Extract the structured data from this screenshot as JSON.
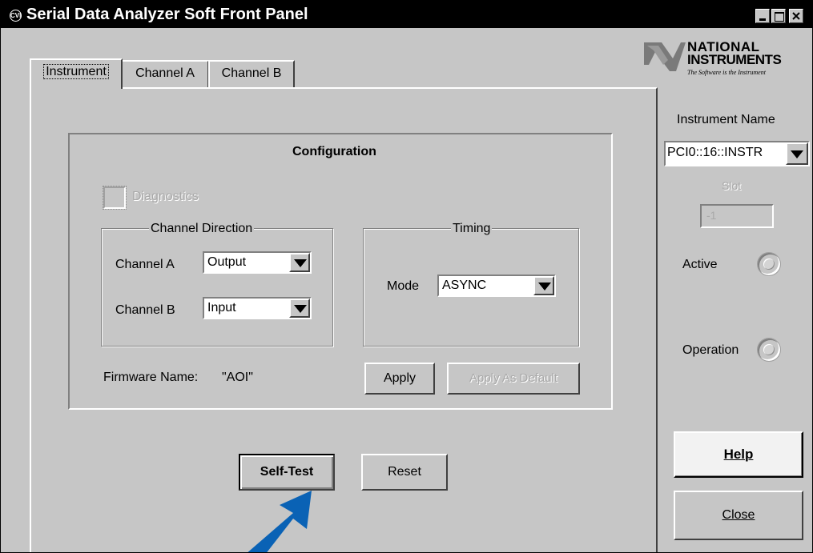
{
  "window": {
    "title": "Serial Data Analyzer Soft Front Panel",
    "app_icon": "CVI",
    "controls": [
      "minimize",
      "maximize",
      "close"
    ]
  },
  "tabs": [
    {
      "label": "Instrument",
      "active": true
    },
    {
      "label": "Channel A",
      "active": false
    },
    {
      "label": "Channel B",
      "active": false
    }
  ],
  "configuration": {
    "title": "Configuration",
    "diagnostics_label": "Diagnostics",
    "diagnostics_enabled": false,
    "channel_direction": {
      "title": "Channel Direction",
      "channel_a_label": "Channel A",
      "channel_a_value": "Output",
      "channel_b_label": "Channel B",
      "channel_b_value": "Input"
    },
    "timing": {
      "title": "Timing",
      "mode_label": "Mode",
      "mode_value": "ASYNC"
    },
    "firmware_label": "Firmware Name:",
    "firmware_value": "\"AOI\"",
    "apply_label": "Apply",
    "apply_default_label": "Apply As Default"
  },
  "actions": {
    "self_test_label": "Self-Test",
    "reset_label": "Reset"
  },
  "logo": {
    "line1": "NATIONAL",
    "line2": "INSTRUMENTS",
    "tagline": "The Software is the Instrument"
  },
  "sidebar": {
    "instrument_name_label": "Instrument Name",
    "instrument_name_value": "PCI0::16::INSTR",
    "slot_label": "Slot",
    "slot_value": "-1",
    "active_label": "Active",
    "operation_label": "Operation",
    "help_label": "Help",
    "close_label": "Close"
  },
  "colors": {
    "panel": "#c6c6c6",
    "arrow": "#0a62b5"
  }
}
